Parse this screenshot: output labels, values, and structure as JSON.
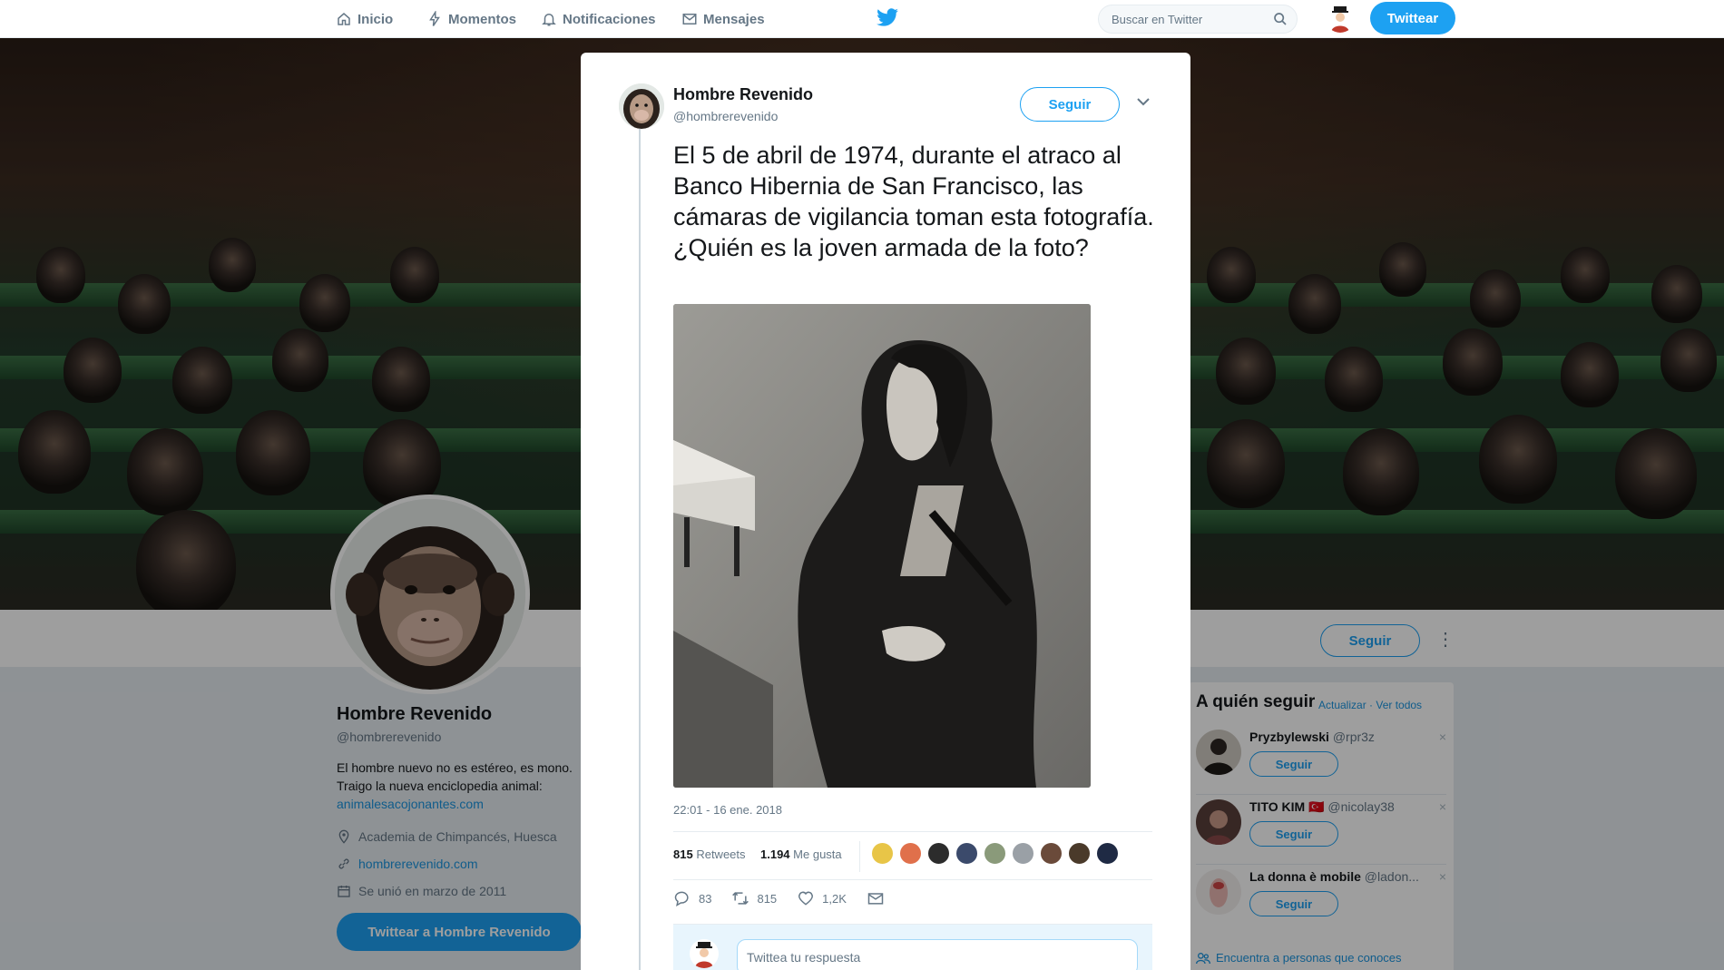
{
  "nav": {
    "items": [
      {
        "label": "Inicio",
        "icon": "home-icon"
      },
      {
        "label": "Momentos",
        "icon": "lightning-icon"
      },
      {
        "label": "Notificaciones",
        "icon": "bell-icon"
      },
      {
        "label": "Mensajes",
        "icon": "envelope-icon"
      }
    ],
    "search_placeholder": "Buscar en Twitter",
    "tweet_button": "Twittear"
  },
  "profile": {
    "name": "Hombre Revenido",
    "handle": "@hombrerevenido",
    "follow_button": "Seguir",
    "bio_line1": "El hombre nuevo no es estéreo, es mono.",
    "bio_line2": "Traigo la nueva enciclopedia animal:",
    "bio_link": "animalesacojonantes.com",
    "location": "Academia de Chimpancés, Huesca",
    "website": "hombrerevenido.com",
    "joined": "Se unió en marzo de 2011",
    "tweet_to_button": "Twittear a Hombre Revenido"
  },
  "who_to_follow": {
    "title": "A quién seguir",
    "refresh": "Actualizar",
    "view_all": "Ver todos",
    "find_people": "Encuentra a personas que conoces",
    "items": [
      {
        "name": "Pryzbylewski",
        "handle": "@rpr3z",
        "follow": "Seguir",
        "close": "×"
      },
      {
        "name": "TITO KIM 🇹🇷",
        "handle": "@nicolay38",
        "follow": "Seguir",
        "close": "×"
      },
      {
        "name": "La donna è mobile",
        "handle": "@ladon...",
        "follow": "Seguir",
        "close": "×"
      }
    ]
  },
  "tweet": {
    "author_name": "Hombre Revenido",
    "author_handle": "@hombrerevenido",
    "follow_button": "Seguir",
    "text": "El 5 de abril de 1974, durante el atraco al Banco Hibernia de San Francisco, las cámaras de vigilancia toman esta fotografía.\n¿Quién es la joven armada de la foto?",
    "timestamp": "22:01 - 16 ene. 2018",
    "retweets_count": "815",
    "retweets_label": "Retweets",
    "likes_count": "1.194",
    "likes_label": "Me gusta",
    "actions": {
      "replies": "83",
      "retweets": "815",
      "likes": "1,2K"
    },
    "reply_placeholder": "Twittea tu respuesta",
    "liker_colors": [
      "#e8c547",
      "#e0704b",
      "#2c2c2c",
      "#3b4a6b",
      "#8a9a7a",
      "#9aa0a6",
      "#6a4a3a",
      "#4a3a2a",
      "#1f2a44"
    ]
  },
  "colors": {
    "accent": "#1da1f2",
    "link": "#1b95e0",
    "muted": "#657786"
  }
}
